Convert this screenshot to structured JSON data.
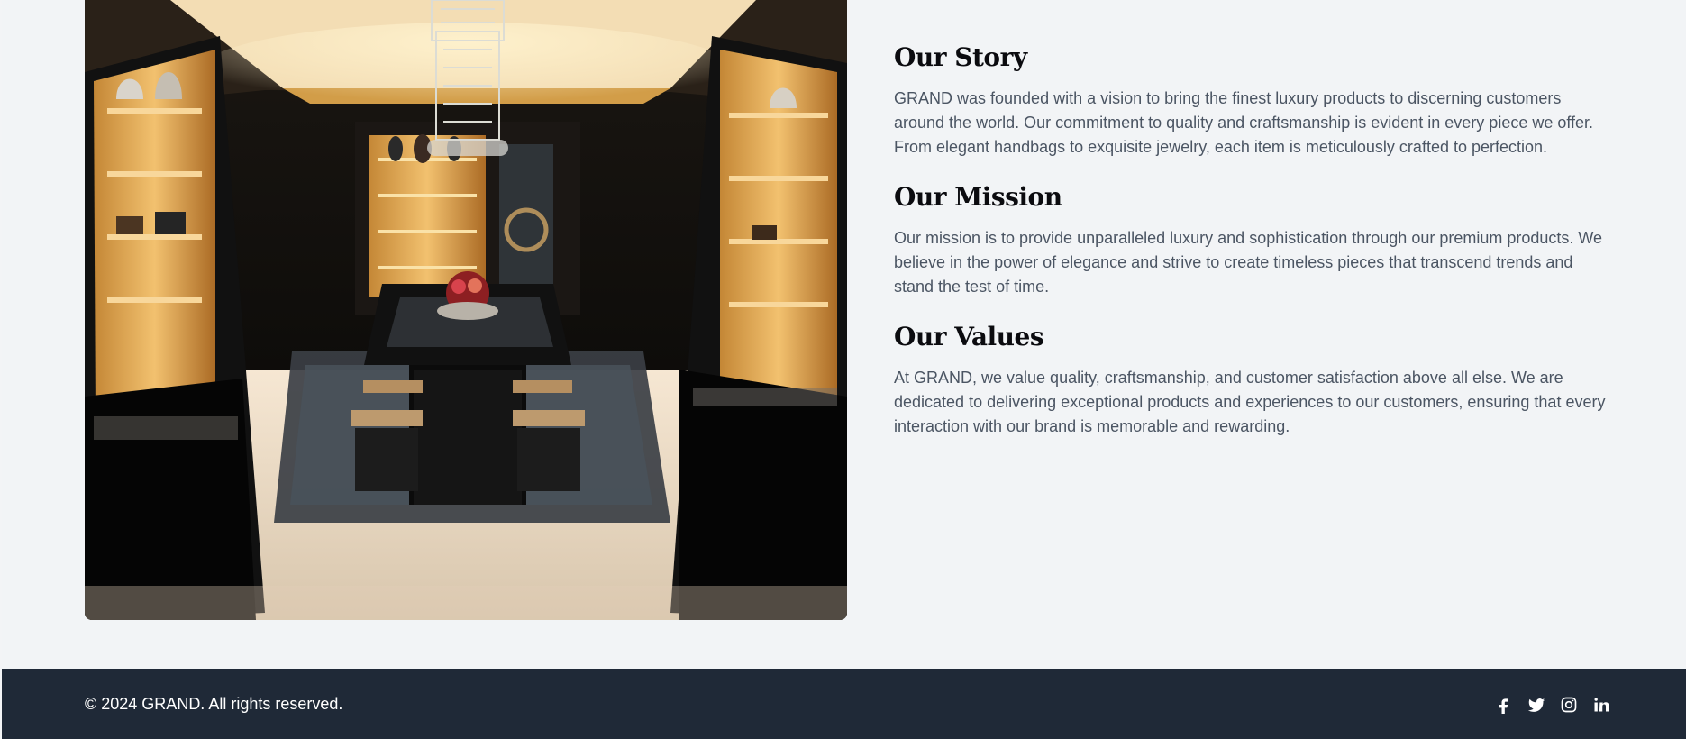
{
  "about": {
    "image_alt": "Luxury boutique interior",
    "sections": [
      {
        "title": "Our Story",
        "body": "GRAND was founded with a vision to bring the finest luxury products to discerning customers around the world. Our commitment to quality and craftsmanship is evident in every piece we offer. From elegant handbags to exquisite jewelry, each item is meticulously crafted to perfection."
      },
      {
        "title": "Our Mission",
        "body": "Our mission is to provide unparalleled luxury and sophistication through our premium products. We believe in the power of elegance and strive to create timeless pieces that transcend trends and stand the test of time."
      },
      {
        "title": "Our Values",
        "body": "At GRAND, we value quality, craftsmanship, and customer satisfaction above all else. We are dedicated to delivering exceptional products and experiences to our customers, ensuring that every interaction with our brand is memorable and rewarding."
      }
    ]
  },
  "footer": {
    "copyright": "© 2024 GRAND. All rights reserved.",
    "social_icons": [
      "facebook-icon",
      "twitter-icon",
      "instagram-icon",
      "linkedin-icon"
    ]
  },
  "colors": {
    "page_background": "#f3f4f6",
    "footer_background": "#1f2937",
    "heading": "#0b0b0f",
    "body_text": "#4b5563",
    "footer_text": "#ffffff"
  }
}
